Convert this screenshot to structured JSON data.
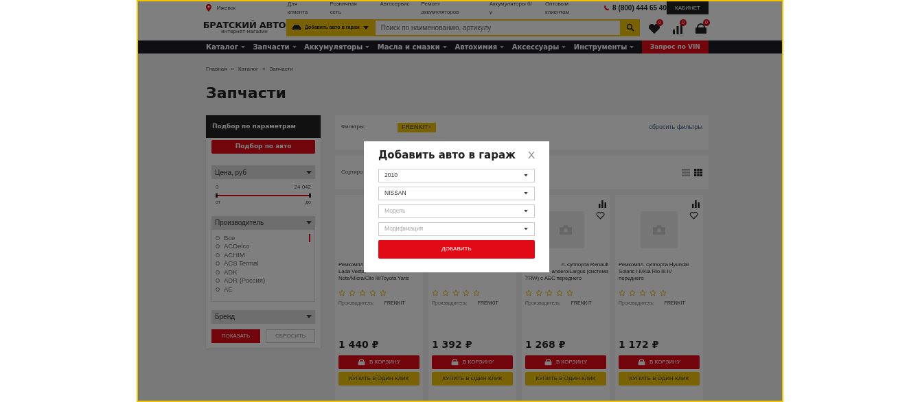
{
  "top_bar": {
    "city": "Ижевск",
    "links": [
      "Для клиента",
      "Розничная сеть",
      "Автосервис",
      "Ремонт аккумуляторов",
      "Аккумуляторы б/у",
      "Оптовым клиентам"
    ],
    "phone": "8 (800) 444 65 40",
    "cabinet": "КАБИНЕТ"
  },
  "header": {
    "logo_title": "БРАТСКИЙ АВТО",
    "logo_subtitle": "интернет-магазин",
    "garage_button": "Добавить авто в гараж",
    "search": {
      "placeholder": "Поиск по наименованию, артикулу"
    },
    "badges": [
      {
        "kind": "favorites",
        "count": "0"
      },
      {
        "kind": "compare",
        "count": "0"
      },
      {
        "kind": "cart",
        "count": "0"
      }
    ]
  },
  "nav": [
    {
      "label": "Каталог",
      "kind": "menu"
    },
    {
      "label": "Запчасти",
      "kind": "menu"
    },
    {
      "label": "Аккумуляторы",
      "kind": "menu"
    },
    {
      "label": "Масла и смазки",
      "kind": "menu"
    },
    {
      "label": "Автохимия",
      "kind": "menu"
    },
    {
      "label": "Аксессуары",
      "kind": "menu"
    },
    {
      "label": "Инструменты",
      "kind": "menu"
    },
    {
      "label": "Запрос по VIN",
      "kind": "action"
    }
  ],
  "breadcrumbs": [
    "Главная",
    "Каталог",
    "Запчасти"
  ],
  "breadcrumb_separator": "»",
  "page_title": "Запчасти",
  "sidebar": {
    "title": "Подбор по параметрам",
    "car_button": "Подбор по авто",
    "price": {
      "label": "Цена, руб",
      "min": "0",
      "max": "24 042",
      "from": "от",
      "to": "до",
      "level": 1
    },
    "manufacturer": {
      "label": "Производитель",
      "options": [
        {
          "label": "Все",
          "checked": false
        },
        {
          "label": "ACDelco",
          "checked": false
        },
        {
          "label": "ACHIM",
          "checked": false
        },
        {
          "label": "ACS Termal",
          "checked": false
        },
        {
          "label": "ADK",
          "checked": false
        },
        {
          "label": "ADR (Россия)",
          "checked": false
        },
        {
          "label": "AE",
          "checked": false
        }
      ]
    },
    "brand": {
      "label": "Бренд"
    },
    "show_button": "ПОКАЗАТЬ",
    "reset_button": "СБРОСИТЬ"
  },
  "filters": {
    "label": "Фильтры:",
    "tags": [
      {
        "label": "FRENKIT",
        "remove": "×"
      }
    ],
    "reset_link": "сбросить фильтры"
  },
  "sort": {
    "label": "Сортиро",
    "views": [
      {
        "kind": "list",
        "selected": false
      },
      {
        "kind": "grid",
        "selected": true
      }
    ]
  },
  "products": [
    {
      "title_lines": [
        {
          "text": "Ремкомпл",
          "kind": "full"
        },
        {
          "text": "Lada Vesta,",
          "kind": "full"
        },
        {
          "text": "Note/Micra/Clio III/Toyota Yaris",
          "kind": "full"
        }
      ],
      "stars": 0,
      "maker_label": "Производитель:",
      "maker": "FRENKIT",
      "price": "1 440 ₽",
      "cart": "В КОРЗИНУ",
      "one_click": "КУПИТЬ В ОДИН КЛИК"
    },
    {
      "stars": 0,
      "maker_label": "Производитель:",
      "maker": "FRENKIT",
      "price": "1 392 ₽",
      "cart": "В КОРЗИНУ",
      "one_click": "КУПИТЬ В ОДИН КЛИК"
    },
    {
      "title_lines": [
        {
          "text": "л. суппорта Renault",
          "kind": "partial"
        },
        {
          "text": "andero/Largus (система",
          "kind": "partial"
        },
        {
          "text": "TRW) с АБС переднего",
          "kind": "full"
        }
      ],
      "stars": 0,
      "maker_label": "Производитель:",
      "maker": "FRENKIT",
      "price": "1 268 ₽",
      "cart": "В КОРЗИНУ",
      "one_click": "КУПИТЬ В ОДИН КЛИК",
      "image": true,
      "actions": true
    },
    {
      "title_lines": [
        {
          "text": "Ремкомпл. суппорта Hyundai",
          "kind": "full"
        },
        {
          "text": "Solaris I-II/Kia Rio III-IV",
          "kind": "full"
        },
        {
          "text": "переднего",
          "kind": "full"
        }
      ],
      "stars": 0,
      "maker_label": "Производитель:",
      "maker": "FRENKIT",
      "price": "1 172 ₽",
      "cart": "В КОРЗИНУ",
      "one_click": "КУПИТЬ В ОДИН КЛИК",
      "image": true,
      "actions": true
    }
  ],
  "modal": {
    "title": "Добавить авто в гараж",
    "close": "X",
    "fields": [
      {
        "value": "2010"
      },
      {
        "value": "NISSAN"
      },
      {
        "placeholder": "Модель"
      },
      {
        "placeholder": "Модификация"
      }
    ],
    "submit": "ДОБАВИТЬ"
  }
}
